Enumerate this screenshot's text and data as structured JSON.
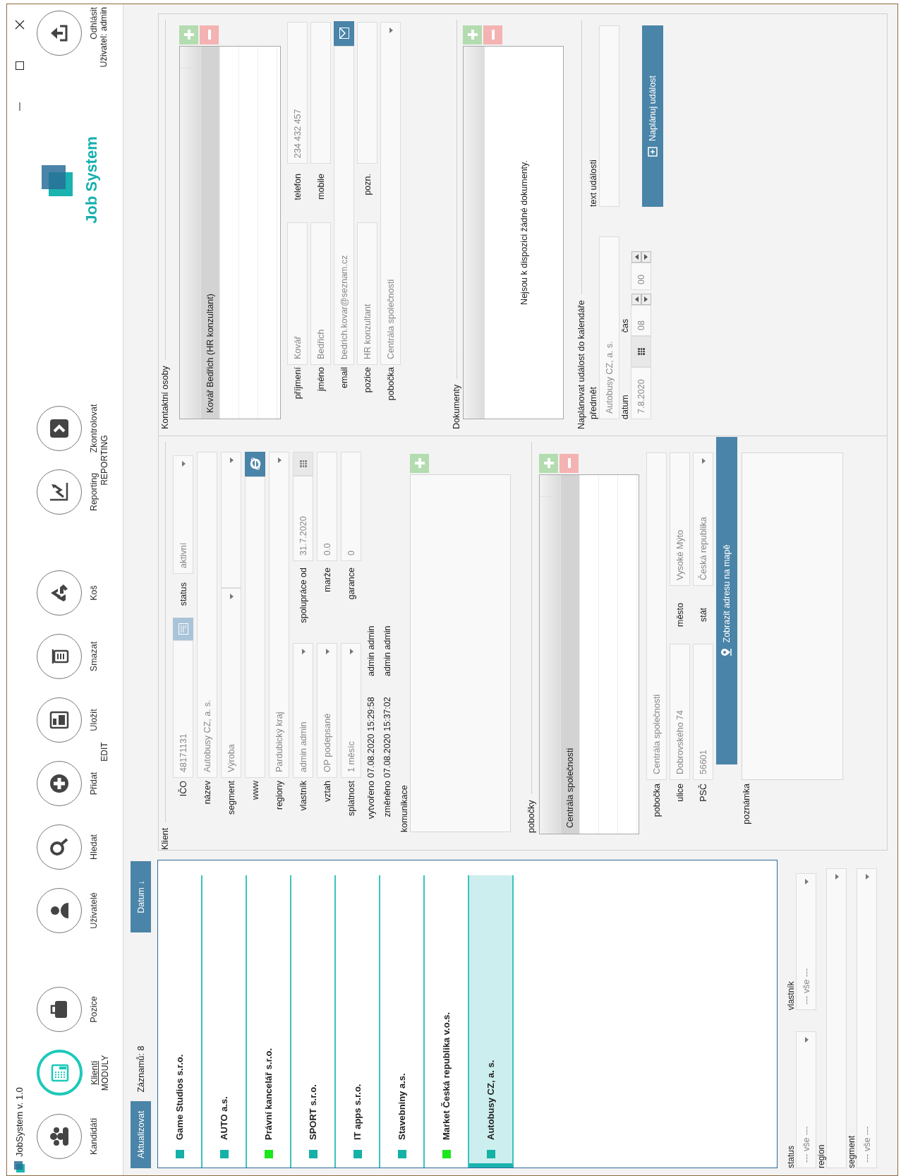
{
  "window": {
    "title": "JobSystem v. 1.0"
  },
  "toolbar": {
    "groups": [
      {
        "label": "MODULY",
        "items": [
          {
            "label": "Kandidáti",
            "selected": false
          },
          {
            "label": "Klienti",
            "selected": true
          },
          {
            "label": "Pozice",
            "selected": false
          }
        ]
      },
      {
        "label": "EDIT",
        "items": [
          {
            "label": "Uživatelé"
          },
          {
            "label": "Hledat"
          },
          {
            "label": "Přidat"
          },
          {
            "label": "Uložit"
          },
          {
            "label": "Smazat"
          },
          {
            "label": "Koš"
          }
        ]
      },
      {
        "label": "REPORTING",
        "items": [
          {
            "label": "Reporting"
          },
          {
            "label": "Zkontrolovat"
          }
        ]
      }
    ],
    "logo": "Job System",
    "logout": "Odhlásit",
    "user": "Uživatel: admin"
  },
  "clients": {
    "refresh": "Aktualizovat",
    "count": "Záznamů: 8",
    "sort": "Datum ↓",
    "rows": [
      {
        "name": "Game Studios s.r.o.",
        "color": "#13b1a6",
        "selected": false
      },
      {
        "name": "AUTO a.s.",
        "color": "#13b1a6",
        "selected": false
      },
      {
        "name": "Právní kancelář s.r.o.",
        "color": "#1be81b",
        "selected": false
      },
      {
        "name": "SPORT s.r.o.",
        "color": "#13b1a6",
        "selected": false
      },
      {
        "name": "IT apps s.r.o.",
        "color": "#13b1a6",
        "selected": false
      },
      {
        "name": "Stavebniny a.s.",
        "color": "#13b1a6",
        "selected": false
      },
      {
        "name": "Market Česká republika v.o.s.",
        "color": "#1be81b",
        "selected": false
      },
      {
        "name": "Autobusy CZ, a. s.",
        "color": "#13b1a6",
        "selected": true
      }
    ]
  },
  "filters": [
    {
      "label": "status",
      "value": "--- vše ---"
    },
    {
      "label": "vlastník",
      "value": "--- vše ---"
    },
    {
      "label": "region"
    },
    {
      "label": "segment",
      "value": "--- vše ---"
    }
  ],
  "client": {
    "legend": "Klient",
    "ico": {
      "label": "IČO",
      "value": "48171131"
    },
    "status": {
      "label": "status",
      "value": "aktivní"
    },
    "name": {
      "label": "název",
      "value": "Autobusy CZ, a. s."
    },
    "segment": {
      "label": "segment",
      "value": "Výroba"
    },
    "www": {
      "label": "www"
    },
    "regions": {
      "label": "regiony",
      "value": "Pardubický kraj"
    },
    "owner": {
      "label": "vlastník",
      "value": "admin admin"
    },
    "since": {
      "label": "spolupráce od",
      "value": "31.7.2020"
    },
    "relation": {
      "label": "vztah",
      "value": "OP podepsané"
    },
    "margin": {
      "label": "marže",
      "value": "0.0"
    },
    "due": {
      "label": "splatnost",
      "value": "1 měsíc"
    },
    "guarantee": {
      "label": "garance",
      "value": "0"
    },
    "created": {
      "label": "vytvořeno",
      "date": "07.08.2020 15:29:58",
      "user": "admin admin"
    },
    "changed": {
      "label": "změněno",
      "date": "07.08.2020 15:37:02",
      "user": "admin admin"
    },
    "communication": {
      "label": "komunikace"
    }
  },
  "branches": {
    "legend": "pobočky",
    "rows": [
      {
        "name": "Centrála společnosti",
        "selected": true
      }
    ],
    "branch": {
      "label": "pobočka",
      "value": "Centrála společnosti"
    },
    "street": {
      "label": "ulice",
      "value": "Dobrovského 74"
    },
    "city": {
      "label": "město",
      "value": "Vysoké Mýto"
    },
    "zip": {
      "label": "PSČ",
      "value": "56601"
    },
    "country": {
      "label": "stát",
      "value": "Česká republika"
    },
    "map_button": "Zobrazit adresu na mapě",
    "note": {
      "label": "poznámka"
    }
  },
  "contacts": {
    "legend": "Kontaktní osoby",
    "rows": [
      {
        "name": "Kovář Bedřich (HR konzultant)",
        "selected": true
      }
    ],
    "surname": {
      "label": "příjmení",
      "value": "Kovář"
    },
    "phone": {
      "label": "telefon",
      "value": "234 432 457"
    },
    "firstname": {
      "label": "jméno",
      "value": "Bedřich"
    },
    "mobile": {
      "label": "mobile"
    },
    "email": {
      "label": "email",
      "value": "bedrich.kovar@seznam.cz"
    },
    "position": {
      "label": "pozice",
      "value": "HR konzultant"
    },
    "note": {
      "label": "pozn."
    },
    "branch": {
      "label": "pobočka",
      "value": "Centrála společnosti"
    }
  },
  "documents": {
    "legend": "Dokumenty",
    "empty": "Nejsou k dispozici žádné dokumenty."
  },
  "event": {
    "legend": "Naplánovat událost do kalendáře",
    "subject": {
      "label": "předmět",
      "value": "Autobusy CZ, a. s."
    },
    "text": {
      "label": "text události"
    },
    "date": {
      "label": "datum",
      "value": "7.8.2020"
    },
    "time": {
      "label": "čas",
      "hour": "08",
      "minute": "00"
    },
    "button": "Naplánuj událost"
  }
}
